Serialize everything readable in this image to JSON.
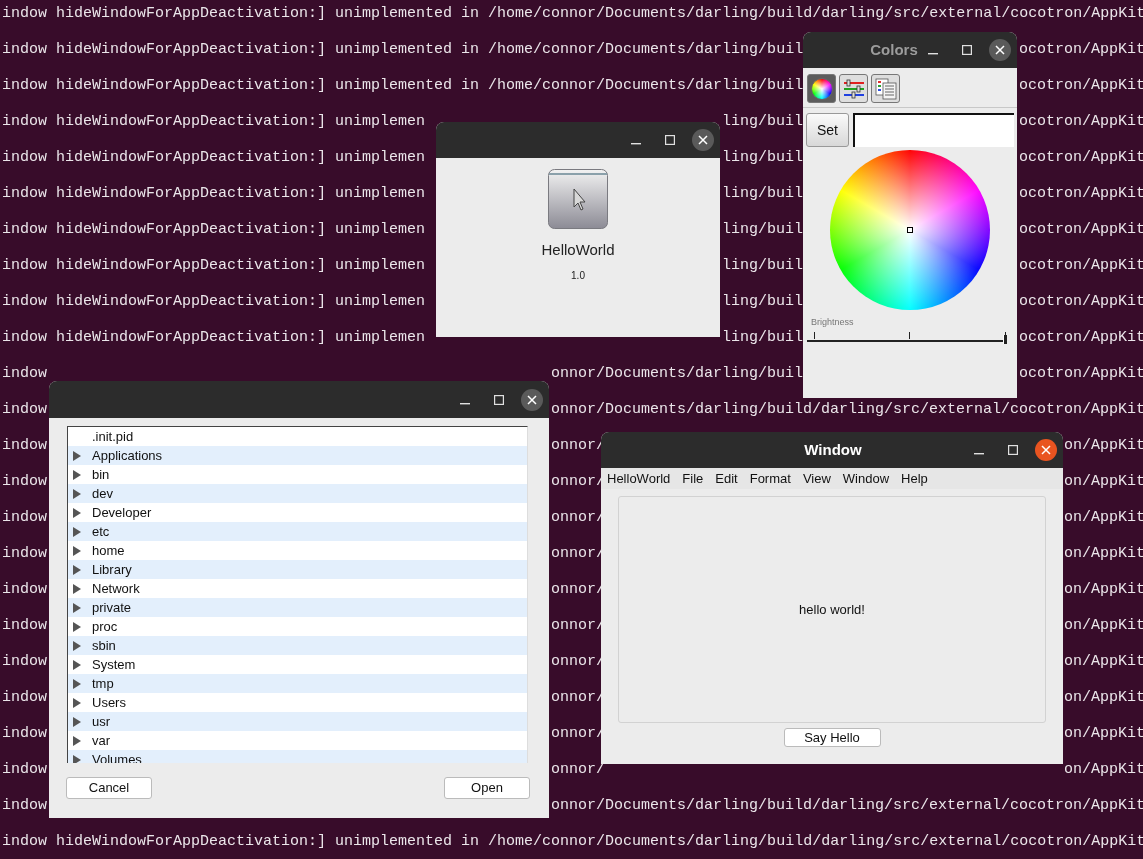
{
  "terminal": {
    "lines": [
      {
        "segments": [
          "indow hideWindowForAppDeactivation:] unimplemented in /home/connor/Documents/darling/build/darling/src/external/cocotron/AppKit"
        ]
      },
      {
        "segments": [
          "indow hideWindowForAppDeactivation:] unimplemented in /home/connor/Documents/darling/buil",
          "ocotron/AppKit"
        ]
      },
      {
        "segments": [
          "indow hideWindowForAppDeactivation:] unimplemented in /home/connor/Documents/darling/buil",
          "ocotron/AppKit"
        ]
      },
      {
        "segments": [
          "indow hideWindowForAppDeactivation:] unimplemen",
          "ling/buil",
          "ocotron/AppKit"
        ]
      },
      {
        "segments": [
          "indow hideWindowForAppDeactivation:] unimplemen",
          "ling/buil",
          "ocotron/AppKit"
        ]
      },
      {
        "segments": [
          "indow hideWindowForAppDeactivation:] unimplemen",
          "ling/buil",
          "ocotron/AppKit"
        ]
      },
      {
        "segments": [
          "indow hideWindowForAppDeactivation:] unimplemen",
          "ling/buil",
          "ocotron/AppKit"
        ]
      },
      {
        "segments": [
          "indow hideWindowForAppDeactivation:] unimplemen",
          "ling/buil",
          "ocotron/AppKit"
        ]
      },
      {
        "segments": [
          "indow hideWindowForAppDeactivation:] unimplemen",
          "ling/buil",
          "ocotron/AppKit"
        ]
      },
      {
        "segments": [
          "indow hideWindowForAppDeactivation:] unimplemen",
          "ling/buil",
          "ocotron/AppKit"
        ]
      },
      {
        "segments": [
          "indow",
          "onnor/Documents/darling/buil",
          "ocotron/AppKit"
        ]
      },
      {
        "segments": [
          "indow",
          "onnor/Documents/darling/build/darling/src/external/cocotron/AppKit"
        ]
      },
      {
        "segments": [
          "indow",
          "onnor/",
          "on/AppKit"
        ]
      },
      {
        "segments": [
          "indow",
          "onnor/",
          "on/AppKit"
        ]
      },
      {
        "segments": [
          "indow",
          "onnor/",
          "on/AppKit"
        ]
      },
      {
        "segments": [
          "indow",
          "onnor/",
          "on/AppKit"
        ]
      },
      {
        "segments": [
          "indow",
          "onnor/",
          "on/AppKit"
        ]
      },
      {
        "segments": [
          "indow",
          "onnor/",
          "on/AppKit"
        ]
      },
      {
        "segments": [
          "indow",
          "onnor/",
          "on/AppKit"
        ]
      },
      {
        "segments": [
          "indow",
          "onnor/",
          "on/AppKit"
        ]
      },
      {
        "segments": [
          "indow",
          "onnor/",
          "on/AppKit"
        ]
      },
      {
        "segments": [
          "indow",
          "onnor/",
          "on/AppKit"
        ]
      },
      {
        "segments": [
          "indow",
          "onnor/Documents/darling/build/darling/src/external/cocotron/AppKit"
        ]
      },
      {
        "segments": [
          "indow hideWindowForAppDeactivation:] unimplemented in /home/connor/Documents/darling/build/darling/src/external/cocotron/AppKit"
        ]
      }
    ]
  },
  "about_window": {
    "focused": false,
    "app_name": "HelloWorld",
    "version": "1.0"
  },
  "colors_window": {
    "title": "Colors",
    "focused": false,
    "modes": [
      {
        "kind": "wheel",
        "selected": true
      },
      {
        "kind": "sliders",
        "selected": false
      },
      {
        "kind": "palettes",
        "selected": false
      }
    ],
    "set_button": "Set",
    "brightness": {
      "label": "Brightness",
      "level": 1
    }
  },
  "file_window": {
    "focused": false,
    "rows": [
      {
        "name": ".init.pid",
        "kind": "file"
      },
      {
        "name": "Applications",
        "kind": "folder",
        "expanded": false
      },
      {
        "name": "bin",
        "kind": "folder",
        "expanded": false
      },
      {
        "name": "dev",
        "kind": "folder",
        "expanded": false
      },
      {
        "name": "Developer",
        "kind": "folder",
        "expanded": false
      },
      {
        "name": "etc",
        "kind": "folder",
        "expanded": false
      },
      {
        "name": "home",
        "kind": "folder",
        "expanded": false
      },
      {
        "name": "Library",
        "kind": "folder",
        "expanded": false
      },
      {
        "name": "Network",
        "kind": "folder",
        "expanded": false
      },
      {
        "name": "private",
        "kind": "folder",
        "expanded": false
      },
      {
        "name": "proc",
        "kind": "folder",
        "expanded": false
      },
      {
        "name": "sbin",
        "kind": "folder",
        "expanded": false
      },
      {
        "name": "System",
        "kind": "folder",
        "expanded": false
      },
      {
        "name": "tmp",
        "kind": "folder",
        "expanded": false
      },
      {
        "name": "Users",
        "kind": "folder",
        "expanded": false
      },
      {
        "name": "usr",
        "kind": "folder",
        "expanded": false
      },
      {
        "name": "var",
        "kind": "folder",
        "expanded": false
      },
      {
        "name": "Volumes",
        "kind": "folder",
        "expanded": false
      }
    ],
    "buttons": [
      "Cancel",
      "Open"
    ]
  },
  "main_window": {
    "title": "Window",
    "focused": true,
    "menu": [
      "HelloWorld",
      "File",
      "Edit",
      "Format",
      "View",
      "Window",
      "Help"
    ],
    "message": "hello world!",
    "button": "Say Hello"
  }
}
